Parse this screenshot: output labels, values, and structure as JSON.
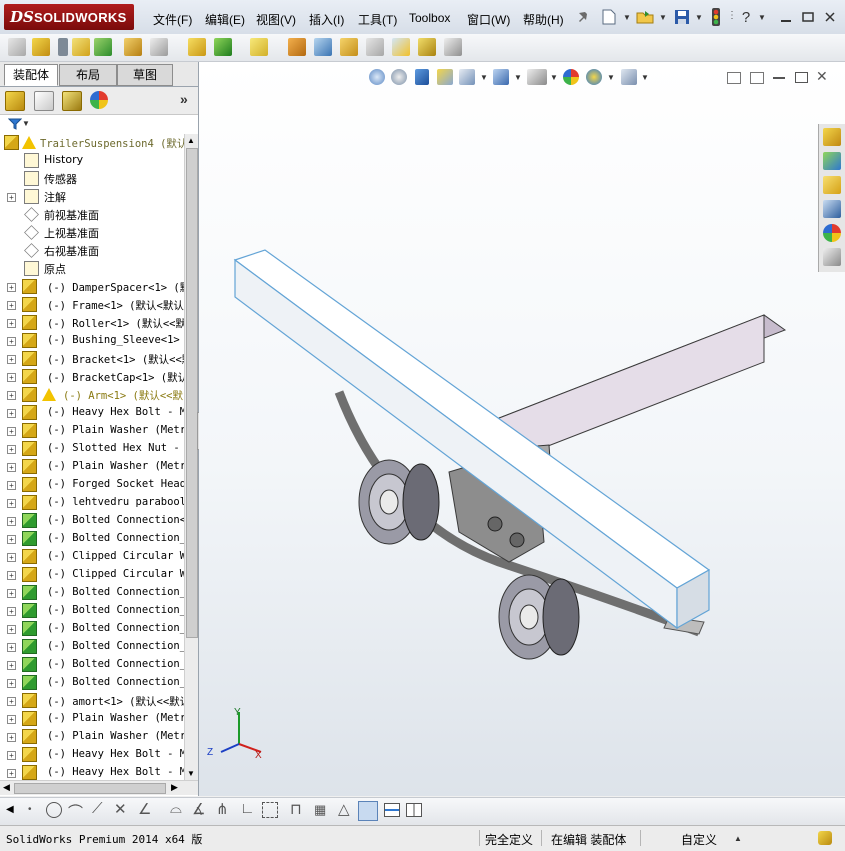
{
  "app": {
    "logo_prefix": "DS",
    "logo_text": "SOLIDWORKS"
  },
  "menu": [
    "文件(F)",
    "编辑(E)",
    "视图(V)",
    "插入(I)",
    "工具(T)",
    "Toolbox",
    "窗口(W)",
    "帮助(H)"
  ],
  "title_icons": [
    "pushpin-icon",
    "new-document-icon",
    "open-folder-icon",
    "save-icon",
    "traffic-light-icon",
    "help-icon"
  ],
  "window_controls": [
    "minimize-icon",
    "restore-icon",
    "close-icon"
  ],
  "panel_tabs": [
    "装配体",
    "布局",
    "草图"
  ],
  "panel_tools": [
    "feature-manager-icon",
    "property-manager-icon",
    "configuration-manager-icon",
    "display-manager-icon",
    "expand-chevron-icon"
  ],
  "filter_icon": "funnel-icon",
  "tree": {
    "root": "TrailerSuspension4  (默认",
    "items": [
      {
        "label": "History",
        "icon": "history-icon",
        "expand": false,
        "indent": 1
      },
      {
        "label": "传感器",
        "icon": "sensor-icon",
        "expand": false,
        "indent": 1
      },
      {
        "label": "注解",
        "icon": "annotation-icon",
        "expand": true,
        "indent": 1
      },
      {
        "label": "前视基准面",
        "icon": "plane-icon",
        "expand": false,
        "indent": 1
      },
      {
        "label": "上视基准面",
        "icon": "plane-icon",
        "expand": false,
        "indent": 1
      },
      {
        "label": "右视基准面",
        "icon": "plane-icon",
        "expand": false,
        "indent": 1
      },
      {
        "label": "原点",
        "icon": "origin-icon",
        "expand": false,
        "indent": 1
      },
      {
        "label": "(-) DamperSpacer<1> (默认",
        "icon": "part-icon",
        "expand": true
      },
      {
        "label": "(-) Frame<1> (默认<默认",
        "icon": "part-icon",
        "expand": true
      },
      {
        "label": "(-) Roller<1> (默认<<默",
        "icon": "part-icon",
        "expand": true
      },
      {
        "label": "(-) Bushing_Sleeve<1> (",
        "icon": "part-icon",
        "expand": true
      },
      {
        "label": "(-) Bracket<1> (默认<<默",
        "icon": "part-icon",
        "expand": true
      },
      {
        "label": "(-) BracketCap<1> (默认<",
        "icon": "part-icon",
        "expand": true
      },
      {
        "label": "(-) Arm<1> (默认<<默",
        "icon": "part-icon",
        "expand": true,
        "warning": true
      },
      {
        "label": "(-) Heavy Hex Bolt - Me",
        "icon": "part-icon",
        "expand": true
      },
      {
        "label": "(-) Plain Washer (Metri",
        "icon": "part-icon",
        "expand": true
      },
      {
        "label": "(-) Slotted Hex Nut - M",
        "icon": "part-icon",
        "expand": true
      },
      {
        "label": "(-) Plain Washer (Metri",
        "icon": "part-icon",
        "expand": true
      },
      {
        "label": "(-) Forged Socket Head",
        "icon": "part-icon",
        "expand": true
      },
      {
        "label": "(-) lehtvedru parabool",
        "icon": "part-icon",
        "expand": true
      },
      {
        "label": "(-) Bolted Connection<1",
        "icon": "assembly-icon",
        "expand": true
      },
      {
        "label": "(-) Bolted Connection_2",
        "icon": "assembly-icon",
        "expand": true
      },
      {
        "label": "(-) Clipped Circular Wa",
        "icon": "part-icon",
        "expand": true
      },
      {
        "label": "(-) Clipped Circular Wa",
        "icon": "part-icon",
        "expand": true
      },
      {
        "label": "(-) Bolted Connection_3",
        "icon": "assembly-icon",
        "expand": true
      },
      {
        "label": "(-) Bolted Connection_4",
        "icon": "assembly-icon",
        "expand": true
      },
      {
        "label": "(-) Bolted Connection_5",
        "icon": "assembly-icon",
        "expand": true
      },
      {
        "label": "(-) Bolted Connection_6",
        "icon": "assembly-icon",
        "expand": true
      },
      {
        "label": "(-) Bolted Connection_7",
        "icon": "assembly-icon",
        "expand": true
      },
      {
        "label": "(-) Bolted Connection_8",
        "icon": "assembly-icon",
        "expand": true
      },
      {
        "label": "(-) amort<1> (默认<<默认",
        "icon": "part-icon",
        "expand": true
      },
      {
        "label": "(-) Plain Washer (Metri",
        "icon": "part-icon",
        "expand": true
      },
      {
        "label": "(-) Plain Washer (Metri",
        "icon": "part-icon",
        "expand": true
      },
      {
        "label": "(-) Heavy Hex Bolt - Me",
        "icon": "part-icon",
        "expand": true
      },
      {
        "label": "(-) Heavy Hex Bolt - Me",
        "icon": "part-icon",
        "expand": true
      }
    ]
  },
  "triad": {
    "x": "X",
    "y": "Y",
    "z": "Z"
  },
  "status": {
    "product": "SolidWorks Premium 2014 x64 版",
    "definition": "完全定义",
    "mode": "在编辑 装配体",
    "custom": "自定义"
  }
}
